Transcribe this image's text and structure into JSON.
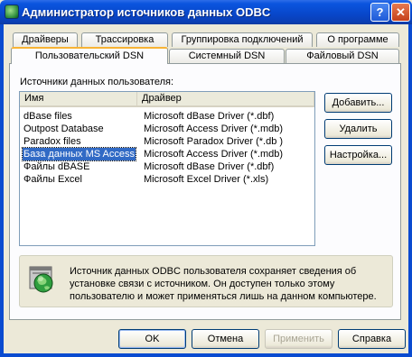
{
  "window": {
    "title": "Администратор источников данных ODBC",
    "help_glyph": "?",
    "close_glyph": "✕"
  },
  "tabs_back": [
    "Драйверы",
    "Трассировка",
    "Группировка подключений",
    "О программе"
  ],
  "tabs_front": [
    "Пользовательский DSN",
    "Системный DSN",
    "Файловый DSN"
  ],
  "active_tab": "Пользовательский DSN",
  "list_label": "Источники данных пользователя:",
  "columns": {
    "name": "Имя",
    "driver": "Драйвер"
  },
  "rows": [
    {
      "name": "dBase files",
      "driver": "Microsoft dBase Driver (*.dbf)"
    },
    {
      "name": "Outpost Database",
      "driver": "Microsoft Access Driver (*.mdb)"
    },
    {
      "name": "Paradox files",
      "driver": "Microsoft Paradox Driver (*.db )"
    },
    {
      "name": "База данных MS Access",
      "driver": "Microsoft Access Driver (*.mdb)"
    },
    {
      "name": "Файлы dBASE",
      "driver": "Microsoft dBase Driver (*.dbf)"
    },
    {
      "name": "Файлы Excel",
      "driver": "Microsoft Excel Driver (*.xls)"
    }
  ],
  "selected_row": 3,
  "side_buttons": {
    "add": "Добавить...",
    "remove": "Удалить",
    "configure": "Настройка..."
  },
  "info_text": "Источник данных ODBC пользователя сохраняет сведения об установке связи с источником.  Он доступен только этому пользователю и может применяться лишь на данном компьютере.",
  "bottom_buttons": {
    "ok": "OK",
    "cancel": "Отмена",
    "apply": "Применить",
    "help": "Справка"
  },
  "colors": {
    "titlebar": "#0a55df",
    "selection": "#316ac5",
    "face": "#ece9d8"
  }
}
